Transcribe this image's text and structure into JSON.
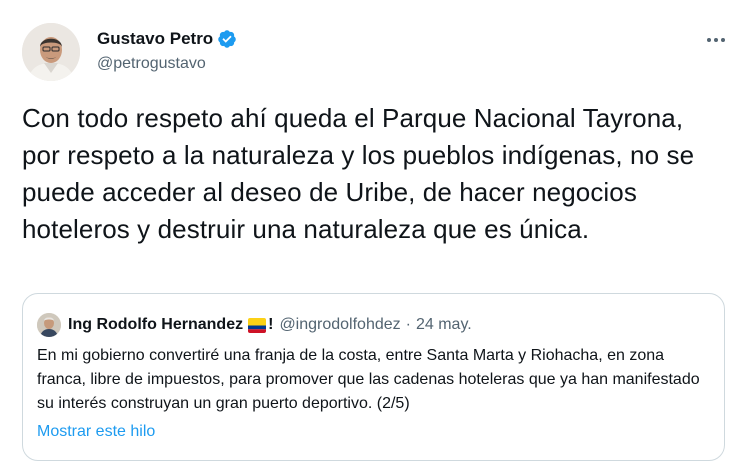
{
  "author": {
    "name": "Gustavo Petro",
    "handle": "@petrogustavo",
    "verified_color": "#1d9bf0"
  },
  "tweet": {
    "text": "Con todo respeto ahí queda el Parque Nacional Tayrona, por respeto a la naturaleza y los pueblos indígenas, no se puede acceder al deseo de Uribe, de hacer negocios hoteleros y destruir una naturaleza que es única."
  },
  "more_icon": "more-horizontal-icon",
  "quote": {
    "name": "Ing Rodolfo Hernandez",
    "name_suffix": "!",
    "flag_icon": "colombia-flag-icon",
    "handle": "@ingrodolfohdez",
    "separator": "·",
    "date": "24 may.",
    "text": "En mi gobierno convertiré una franja de la costa, entre Santa Marta y Riohacha, en zona franca, libre de impuestos, para promover que las cadenas hoteleras que ya han manifestado su interés construyan un gran puerto deportivo. (2/5)",
    "show_thread": "Mostrar este hilo"
  },
  "colors": {
    "text_primary": "#0f1419",
    "text_secondary": "#536471",
    "link": "#1d9bf0",
    "border": "#cfd9de"
  }
}
